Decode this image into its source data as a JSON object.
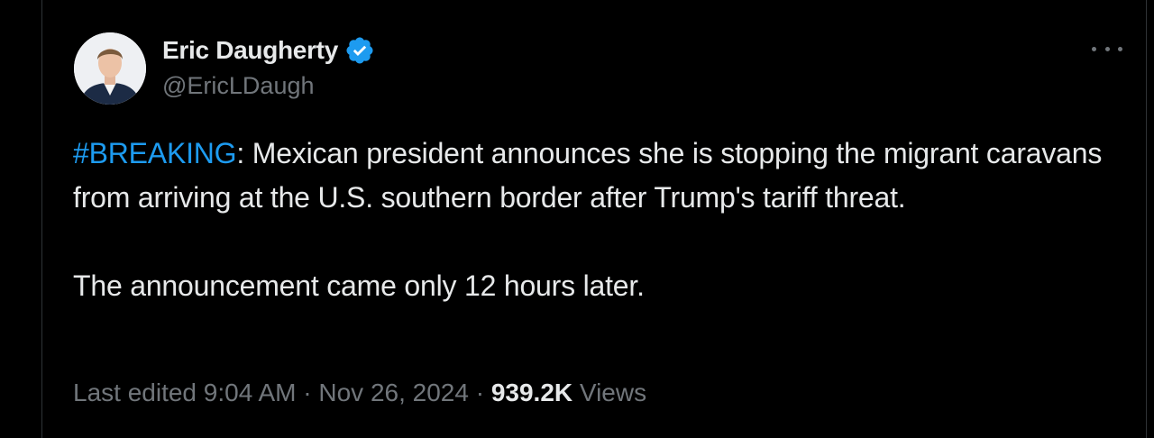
{
  "tweet": {
    "author": {
      "display_name": "Eric Daugherty",
      "handle": "@EricLDaugh",
      "verified": true
    },
    "body": {
      "hashtag": "#BREAKING",
      "line1_rest": ": Mexican president announces she is stopping the migrant caravans from arriving at the U.S. southern border after Trump's tariff threat.",
      "paragraph2": "The announcement came only 12 hours later."
    },
    "meta": {
      "edited_label": "Last edited 9:04 AM · Nov 26, 2024 · ",
      "views_count": "939.2K",
      "views_label": " Views"
    }
  },
  "colors": {
    "background": "#000000",
    "text": "#e7e9ea",
    "muted": "#71767b",
    "link": "#1d9bf0",
    "verified_badge": "#1d9bf0"
  },
  "icons": {
    "verified": "verified-badge-icon",
    "more": "more-options-icon"
  }
}
